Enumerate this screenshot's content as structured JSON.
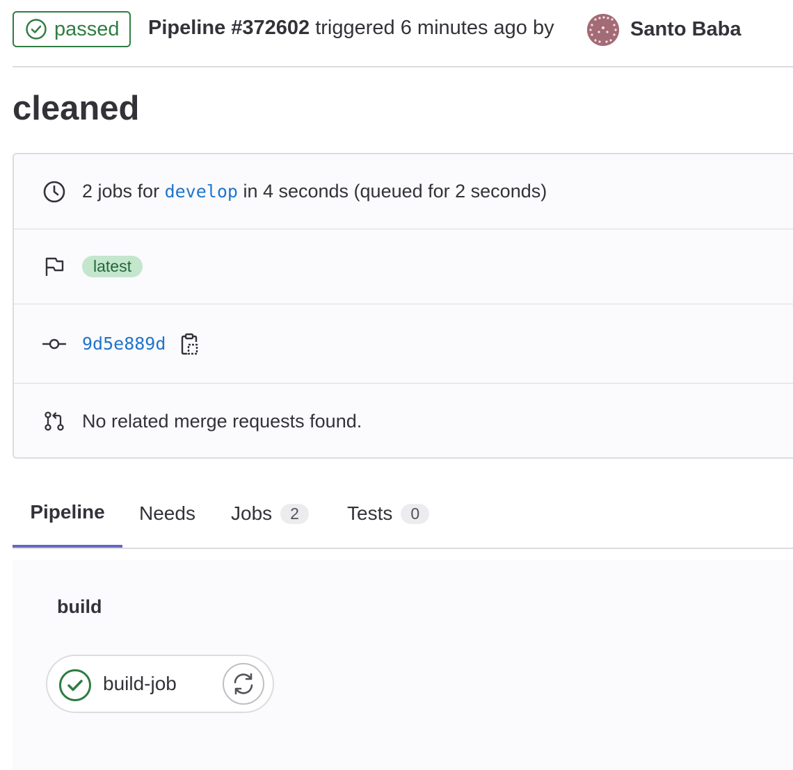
{
  "header": {
    "status": "passed",
    "pipeline_id": "Pipeline #372602",
    "triggered_text": "triggered 6 minutes ago by",
    "author": "Santo Baba"
  },
  "title": "cleaned",
  "info": {
    "jobs_prefix": "2 jobs for",
    "branch": "develop",
    "jobs_suffix": "in 4 seconds (queued for 2 seconds)",
    "tag": "latest",
    "commit_sha": "9d5e889d",
    "merge_requests": "No related merge requests found."
  },
  "tabs": [
    {
      "label": "Pipeline"
    },
    {
      "label": "Needs"
    },
    {
      "label": "Jobs",
      "count": "2"
    },
    {
      "label": "Tests",
      "count": "0"
    }
  ],
  "stage": {
    "name": "build",
    "job": "build-job"
  },
  "colors": {
    "success": "#2f7d42",
    "link": "#1f75cb",
    "tab_active": "#6666c4"
  }
}
